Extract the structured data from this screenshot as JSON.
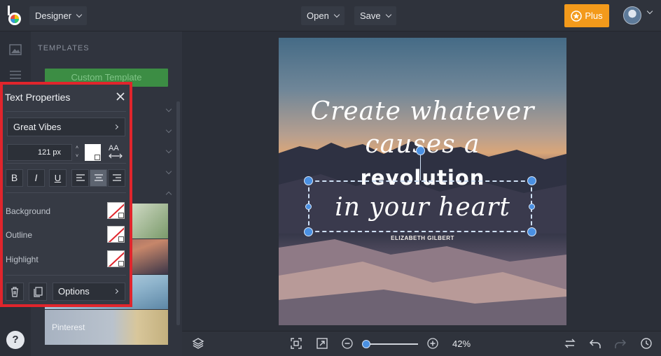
{
  "topbar": {
    "app_menu_label": "Designer",
    "open_label": "Open",
    "save_label": "Save",
    "plus_label": "Plus"
  },
  "sidebar": {
    "section_title": "TEMPLATES",
    "custom_template_label": "Custom Template",
    "thumb_pinterest_label": "Pinterest"
  },
  "text_properties": {
    "title": "Text Properties",
    "font": "Great Vibes",
    "font_size": "121 px",
    "aa_label": "AA",
    "bold_label": "B",
    "italic_label": "I",
    "underline_label": "U",
    "background_label": "Background",
    "outline_label": "Outline",
    "highlight_label": "Highlight",
    "options_label": "Options",
    "text_color": "#ffffff"
  },
  "canvas": {
    "quote_line1": "Create whatever",
    "quote_line2": "causes a",
    "quote_line3": "revolution",
    "quote_line4": "in your heart",
    "author": "ELIZABETH GILBERT"
  },
  "bottombar": {
    "zoom_value": "42%",
    "zoom_level": 0.08
  },
  "colors": {
    "accent": "#f39a1b",
    "selection": "#4a90e2",
    "highlight_border": "#e0252c",
    "custom_template_green": "#3c8d44"
  }
}
